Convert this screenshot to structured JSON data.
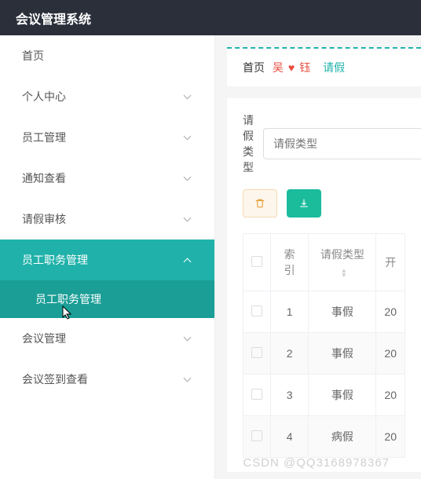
{
  "header": {
    "title": "会议管理系统"
  },
  "sidebar": {
    "items": [
      {
        "label": "首页",
        "expandable": false
      },
      {
        "label": "个人中心",
        "expandable": true
      },
      {
        "label": "员工管理",
        "expandable": true
      },
      {
        "label": "通知查看",
        "expandable": true
      },
      {
        "label": "请假审核",
        "expandable": true
      },
      {
        "label": "员工职务管理",
        "expandable": true,
        "active": true,
        "sub": {
          "label": "员工职务管理"
        }
      },
      {
        "label": "会议管理",
        "expandable": true
      },
      {
        "label": "会议签到查看",
        "expandable": true
      }
    ]
  },
  "breadcrumb": {
    "home": "首页",
    "user_left": "吴",
    "heart": "♥",
    "user_right": "钰",
    "page": "请假"
  },
  "filter": {
    "label": "请假类型",
    "placeholder": "请假类型"
  },
  "table": {
    "headers": {
      "index": "索引",
      "type": "请假类型",
      "col3": "开"
    },
    "rows": [
      {
        "index": "1",
        "type": "事假",
        "col3": "20"
      },
      {
        "index": "2",
        "type": "事假",
        "col3": "20"
      },
      {
        "index": "3",
        "type": "事假",
        "col3": "20"
      },
      {
        "index": "4",
        "type": "病假",
        "col3": "20"
      }
    ]
  },
  "watermark": "CSDN @QQ3168978367"
}
